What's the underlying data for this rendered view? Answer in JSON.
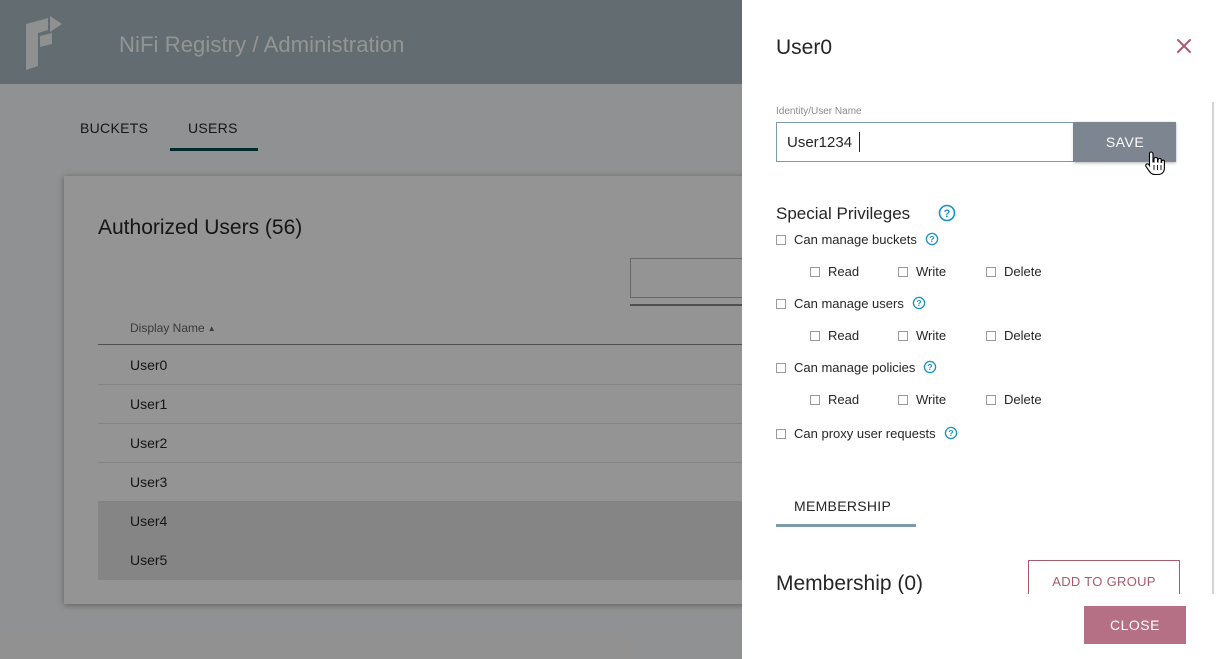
{
  "app": {
    "title": "NiFi Registry / Administration",
    "tabs": [
      {
        "label": "BUCKETS",
        "active": false
      },
      {
        "label": "USERS",
        "active": true
      }
    ]
  },
  "users_card": {
    "title": "Authorized Users (56)",
    "column_header": "Display Name",
    "sort_icon": "sort-ascending-icon",
    "rows": [
      "User0",
      "User1",
      "User2",
      "User3",
      "User4",
      "User5"
    ],
    "highlighted_rows": [
      "User4",
      "User5"
    ]
  },
  "dialog": {
    "title": "User0",
    "field_label": "Identity/User Name",
    "identity_value": "User1234",
    "save_label": "SAVE",
    "special_privileges_title": "Special Privileges",
    "privileges": [
      {
        "label": "Can manage buckets",
        "checked": false,
        "perms": [
          "Read",
          "Write",
          "Delete"
        ]
      },
      {
        "label": "Can manage users",
        "checked": false,
        "perms": [
          "Read",
          "Write",
          "Delete"
        ]
      },
      {
        "label": "Can manage policies",
        "checked": false,
        "perms": [
          "Read",
          "Write",
          "Delete"
        ]
      },
      {
        "label": "Can proxy user requests",
        "checked": false
      }
    ],
    "membership_tab": "MEMBERSHIP",
    "membership_title": "Membership (0)",
    "add_to_group_label": "ADD TO GROUP",
    "close_label": "CLOSE"
  },
  "colors": {
    "header_bg": "#aabbc3",
    "accent": "#004849",
    "save_bg": "#7c8590",
    "close_bg": "#b57085",
    "add_group_border": "#a85a6f",
    "help_icon": "#1491c1"
  }
}
